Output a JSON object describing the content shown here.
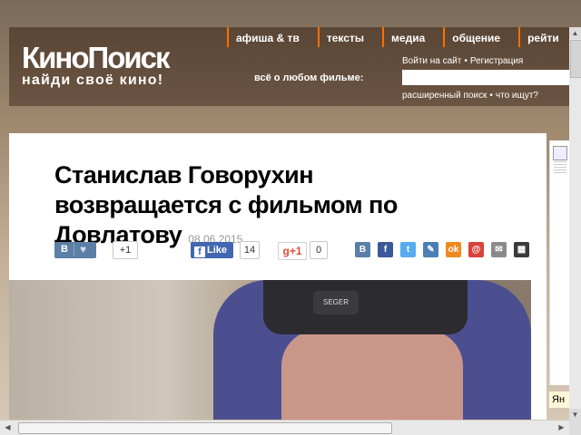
{
  "header": {
    "logo_main": "КиноПоиск",
    "logo_sub": "найди своё кино!",
    "nav": [
      "афиша & тв",
      "тексты",
      "медиа",
      "общение",
      "рейти"
    ],
    "tagline": "всё о любом фильме:",
    "login": "Войти на сайт",
    "register": "Регистрация",
    "advanced_search": "расширенный поиск",
    "what_search": "что ищут?",
    "search_placeholder": ""
  },
  "article": {
    "title": "Станислав Говорухин возвращается с фильмом по Довлатову",
    "date": "08.06.2015"
  },
  "share": {
    "vk_letter": "B",
    "vk_heart": "♥",
    "vk_count": "+1",
    "fb_letter": "f",
    "fb_label": "Like",
    "fb_count": "14",
    "gplus_label": "g+1",
    "gplus_count": "0",
    "icons": [
      {
        "name": "vkontakte-share-icon",
        "glyph": "B",
        "color": "#5b7fa6"
      },
      {
        "name": "facebook-share-icon",
        "glyph": "f",
        "color": "#3b5998"
      },
      {
        "name": "twitter-share-icon",
        "glyph": "t",
        "color": "#55acee"
      },
      {
        "name": "livejournal-share-icon",
        "glyph": "✎",
        "color": "#4a7fb5"
      },
      {
        "name": "odnoklassniki-share-icon",
        "glyph": "ok",
        "color": "#ef8a1e"
      },
      {
        "name": "moimir-share-icon",
        "glyph": "@",
        "color": "#d8423a"
      },
      {
        "name": "email-share-icon",
        "glyph": "✉",
        "color": "#8a8a8a"
      },
      {
        "name": "qrcode-share-icon",
        "glyph": "▦",
        "color": "#3a3a3a"
      }
    ]
  },
  "photo": {
    "hat_logo": "SEGER"
  },
  "side": {
    "ya_label": "Ян"
  }
}
